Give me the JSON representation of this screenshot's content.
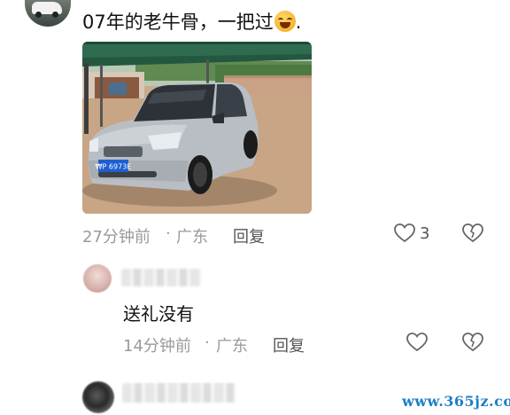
{
  "comment1": {
    "text": "07年的老牛骨，一把过",
    "text_tail": ".",
    "emoji": "laughing-face-icon",
    "time": "27分钟前",
    "separator": "·",
    "location": "广东",
    "reply_label": "回复",
    "like_count": "3",
    "photo": {
      "plate": "₩P 6973E"
    }
  },
  "comment2": {
    "text": "送礼没有",
    "time": "14分钟前",
    "separator": "·",
    "location": "广东",
    "reply_label": "回复"
  },
  "watermark": "www.365jz.com",
  "colors": {
    "meta_gray": "#9a9a9a",
    "watermark_blue": "#1e7fc4",
    "canopy_green": "#2f6b4f"
  }
}
